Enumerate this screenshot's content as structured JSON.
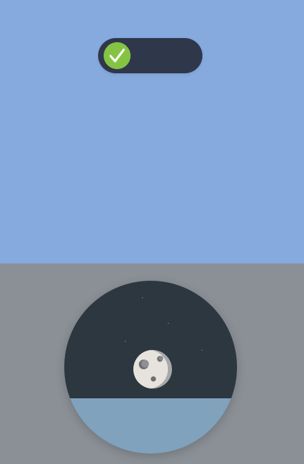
{
  "colors": {
    "top_background": "#86a9de",
    "bottom_background": "#8b9096",
    "toggle_track": "#2f384b",
    "toggle_knob": "#85c443",
    "checkmark": "#ffffff",
    "night_sky": "#2c3740",
    "water": "#81a2bd",
    "star": "#cfd6da",
    "moon_light": "#e6e3dc",
    "moon_shadow": "#a7a8ab",
    "crater": "#6e6f72"
  },
  "toggle": {
    "state": "on",
    "knob_icon": "check-icon"
  },
  "scene": {
    "mode": "night",
    "moon_icon": "moon-icon"
  }
}
